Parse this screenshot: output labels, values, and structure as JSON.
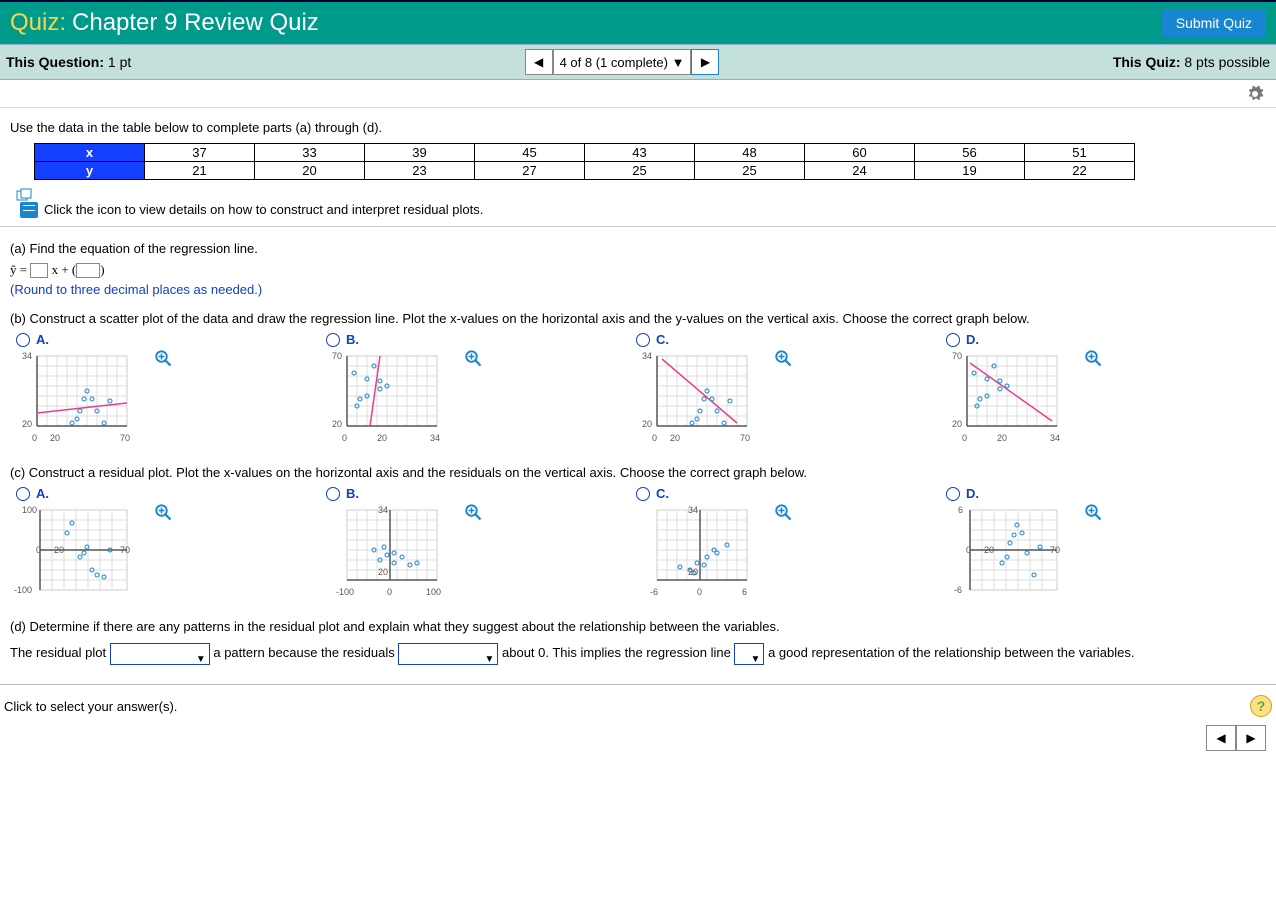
{
  "header": {
    "quiz_label": "Quiz:",
    "quiz_title": "Chapter 9 Review Quiz",
    "submit": "Submit Quiz"
  },
  "status": {
    "this_question_label": "This Question: ",
    "this_question_pts": "1 pt",
    "nav_text": "4 of 8 (1 complete)",
    "this_quiz_label": "This Quiz: ",
    "this_quiz_pts": "8 pts possible"
  },
  "prompt": "Use the data in the table below to complete parts (a) through (d).",
  "table": {
    "row_labels": [
      "x",
      "y"
    ],
    "x": [
      37,
      33,
      39,
      45,
      43,
      48,
      60,
      56,
      51
    ],
    "y": [
      21,
      20,
      23,
      27,
      25,
      25,
      24,
      19,
      22
    ]
  },
  "help_text": "Click the icon to view details on how to construct and interpret residual plots.",
  "part_a": {
    "label": "(a) Find the equation of the regression line.",
    "eqn_prefix": "ŷ =",
    "eqn_mid": "x + (",
    "eqn_suffix": ")",
    "round_note": "(Round to three decimal places as needed.)"
  },
  "part_b": {
    "label": "(b) Construct a scatter plot of the data and draw the regression line. Plot the x-values on the horizontal axis and the y-values on the vertical axis. Choose the correct graph below.",
    "options": [
      "A.",
      "B.",
      "C.",
      "D."
    ],
    "axes": {
      "A": {
        "ymin": 20,
        "ymax": 34,
        "xmin": 0,
        "xmax": 70,
        "ticks_x": [
          "0",
          "20",
          "70"
        ],
        "ticks_y": [
          "20",
          "34"
        ]
      },
      "B": {
        "ymin": 20,
        "ymax": 70,
        "xmin": 0,
        "xmax": 34,
        "ticks_x": [
          "0",
          "20",
          "34"
        ],
        "ticks_y": [
          "20",
          "70"
        ]
      },
      "C": {
        "ymin": 20,
        "ymax": 34,
        "xmin": 0,
        "xmax": 70,
        "ticks_x": [
          "0",
          "20",
          "70"
        ],
        "ticks_y": [
          "20",
          "34"
        ]
      },
      "D": {
        "ymin": 20,
        "ymax": 70,
        "xmin": 0,
        "xmax": 34,
        "ticks_x": [
          "0",
          "20",
          "34"
        ],
        "ticks_y": [
          "20",
          "70"
        ]
      }
    }
  },
  "part_c": {
    "label": "(c) Construct a residual plot. Plot the x-values on the horizontal axis and the residuals on the vertical axis. Choose the correct graph below.",
    "options": [
      "A.",
      "B.",
      "C.",
      "D."
    ],
    "axes": {
      "A": {
        "ymin": -100,
        "ymax": 100,
        "xmin": 0,
        "xmax": 70,
        "ticks_x": [
          "0",
          "20",
          "70"
        ],
        "ticks_y": [
          "-100",
          "100"
        ]
      },
      "B": {
        "ymin": 20,
        "ymax": 34,
        "xmin": -100,
        "xmax": 100,
        "ticks_x": [
          "-100",
          "0",
          "100"
        ],
        "ticks_y": [
          "20",
          "34"
        ]
      },
      "C": {
        "ymin": 20,
        "ymax": 34,
        "xmin": -6,
        "xmax": 6,
        "ticks_x": [
          "-6",
          "0",
          "6"
        ],
        "ticks_y": [
          "20",
          "34"
        ]
      },
      "D": {
        "ymin": -6,
        "ymax": 6,
        "xmin": 0,
        "xmax": 70,
        "ticks_x": [
          "0",
          "20",
          "70"
        ],
        "ticks_y": [
          "-6",
          "6"
        ]
      }
    }
  },
  "part_d": {
    "label": "(d) Determine if there are any patterns in the residual plot and explain what they suggest about the relationship between the variables.",
    "s1": "The residual plot ",
    "s2": " a pattern because the residuals ",
    "s3": " about 0. This implies the regression line ",
    "s4": " a good representation of the relationship between the variables."
  },
  "footer_hint": "Click to select your answer(s).",
  "chart_data": {
    "type": "table",
    "title": "Data set for regression (parts a–d)",
    "columns": [
      "x",
      "y"
    ],
    "rows": [
      [
        37,
        21
      ],
      [
        33,
        20
      ],
      [
        39,
        23
      ],
      [
        45,
        27
      ],
      [
        43,
        25
      ],
      [
        48,
        25
      ],
      [
        60,
        24
      ],
      [
        56,
        19
      ],
      [
        51,
        22
      ]
    ]
  }
}
